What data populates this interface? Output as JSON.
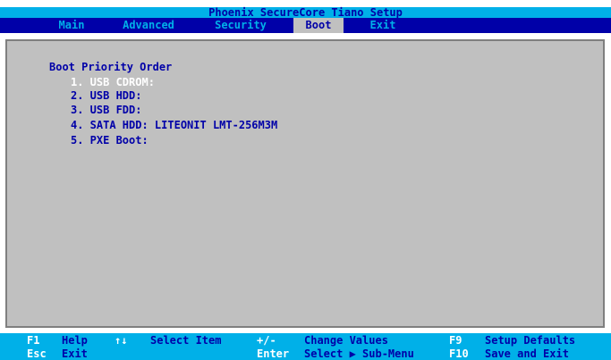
{
  "title": "Phoenix SecureCore Tiano Setup",
  "menu": [
    {
      "label": "Main",
      "active": false
    },
    {
      "label": "Advanced",
      "active": false
    },
    {
      "label": "Security",
      "active": false
    },
    {
      "label": "Boot",
      "active": true
    },
    {
      "label": "Exit",
      "active": false
    }
  ],
  "boot": {
    "section_title": "Boot Priority Order",
    "items": [
      "1. USB CDROM:",
      "2. USB HDD:",
      "3. USB FDD:",
      "4. SATA HDD: LITEONIT LMT-256M3M",
      "5. PXE Boot:"
    ],
    "selected_index": 0
  },
  "help": {
    "row1": [
      {
        "key": "F1",
        "desc": "Help"
      },
      {
        "key": "↑↓",
        "desc": "Select Item"
      },
      {
        "key": "+/-",
        "desc": "Change Values"
      },
      {
        "key": "F9",
        "desc": "Setup Defaults"
      }
    ],
    "row2": [
      {
        "key": "Esc",
        "desc": "Exit"
      },
      {
        "key": "Enter",
        "desc": "Select ▶ Sub-Menu"
      },
      {
        "key": "F10",
        "desc": "Save and Exit"
      }
    ]
  },
  "colors": {
    "bios_blue": "#0000a8",
    "bios_cyan": "#00b0e8",
    "panel_gray": "#c0c0c0",
    "highlight_white": "#ffffff"
  }
}
